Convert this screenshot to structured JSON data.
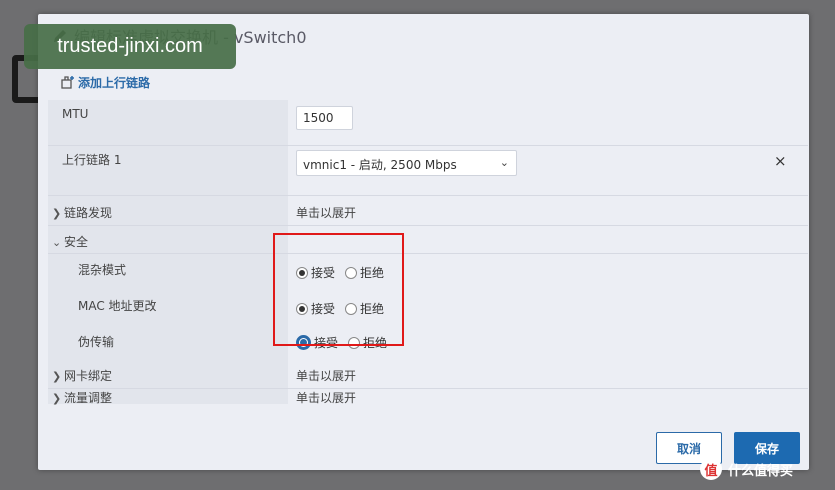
{
  "dialog": {
    "title": "编辑标准虚拟交换机 - vSwitch0"
  },
  "toolbar": {
    "add_uplink_label": "添加上行链路"
  },
  "form": {
    "mtu": {
      "label": "MTU",
      "value": "1500"
    },
    "uplink1": {
      "label": "上行链路 1",
      "value": "vmnic1 - 启动, 2500 Mbps",
      "close_glyph": "×"
    },
    "link_discovery": {
      "label": "链路发现",
      "value": "单击以展开"
    },
    "security": {
      "label": "安全",
      "promiscuous": {
        "label": "混杂模式",
        "accept": "接受",
        "reject": "拒绝",
        "selected": "accept"
      },
      "mac_change": {
        "label": "MAC 地址更改",
        "accept": "接受",
        "reject": "拒绝",
        "selected": "accept"
      },
      "forged": {
        "label": "伪传输",
        "accept": "接受",
        "reject": "拒绝",
        "selected": "accept"
      }
    },
    "nic_teaming": {
      "label": "网卡绑定",
      "value": "单击以展开"
    },
    "traffic_shaping": {
      "label": "流量调整",
      "value": "单击以展开"
    }
  },
  "footer": {
    "cancel_label": "取消",
    "save_label": "保存"
  },
  "watermark": {
    "text": "trusted-jinxi.com"
  },
  "brand": {
    "text": "什么值得买",
    "logo_glyph": "值"
  },
  "colors": {
    "accent": "#1d6ab1",
    "highlight": "#e01919",
    "watermark_bg": "#466e46"
  }
}
